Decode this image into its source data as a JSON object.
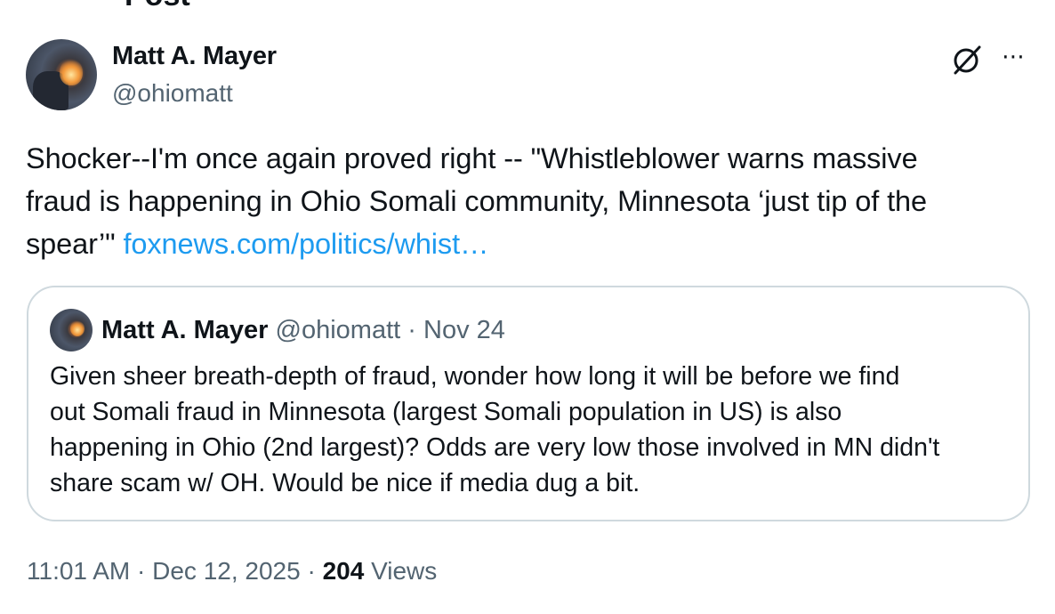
{
  "page_header": "Post",
  "author": {
    "name": "Matt A. Mayer",
    "handle": "@ohiomatt"
  },
  "icons": {
    "grok": "grok-icon",
    "more": "more-icon"
  },
  "post": {
    "text_lines": [
      "Shocker--I'm once again proved right -- \"Whistleblower warns massive",
      "fraud is happening in Ohio Somali community, Minnesota ‘just tip of the",
      "spear’\" "
    ],
    "link_text": "foxnews.com/politics/whist…"
  },
  "quoted_post": {
    "name": "Matt A. Mayer",
    "handle": "@ohiomatt",
    "separator": "·",
    "date": "Nov 24",
    "text_lines": [
      "Given sheer breath-depth of fraud, wonder how long it will be before we find",
      "out Somali fraud in Minnesota (largest Somali population in US) is also",
      "happening in Ohio (2nd largest)? Odds are very low those involved in MN didn't",
      "share scam w/ OH. Would be nice if media dug a bit."
    ]
  },
  "meta": {
    "time": "11:01 AM",
    "sep1": " · ",
    "date": "Dec 12, 2025",
    "sep2": " · ",
    "views_count": "204",
    "views_label": " Views"
  },
  "colors": {
    "text": "#0f1419",
    "secondary": "#536471",
    "link": "#1d9bf0",
    "border": "#cfd9de"
  }
}
